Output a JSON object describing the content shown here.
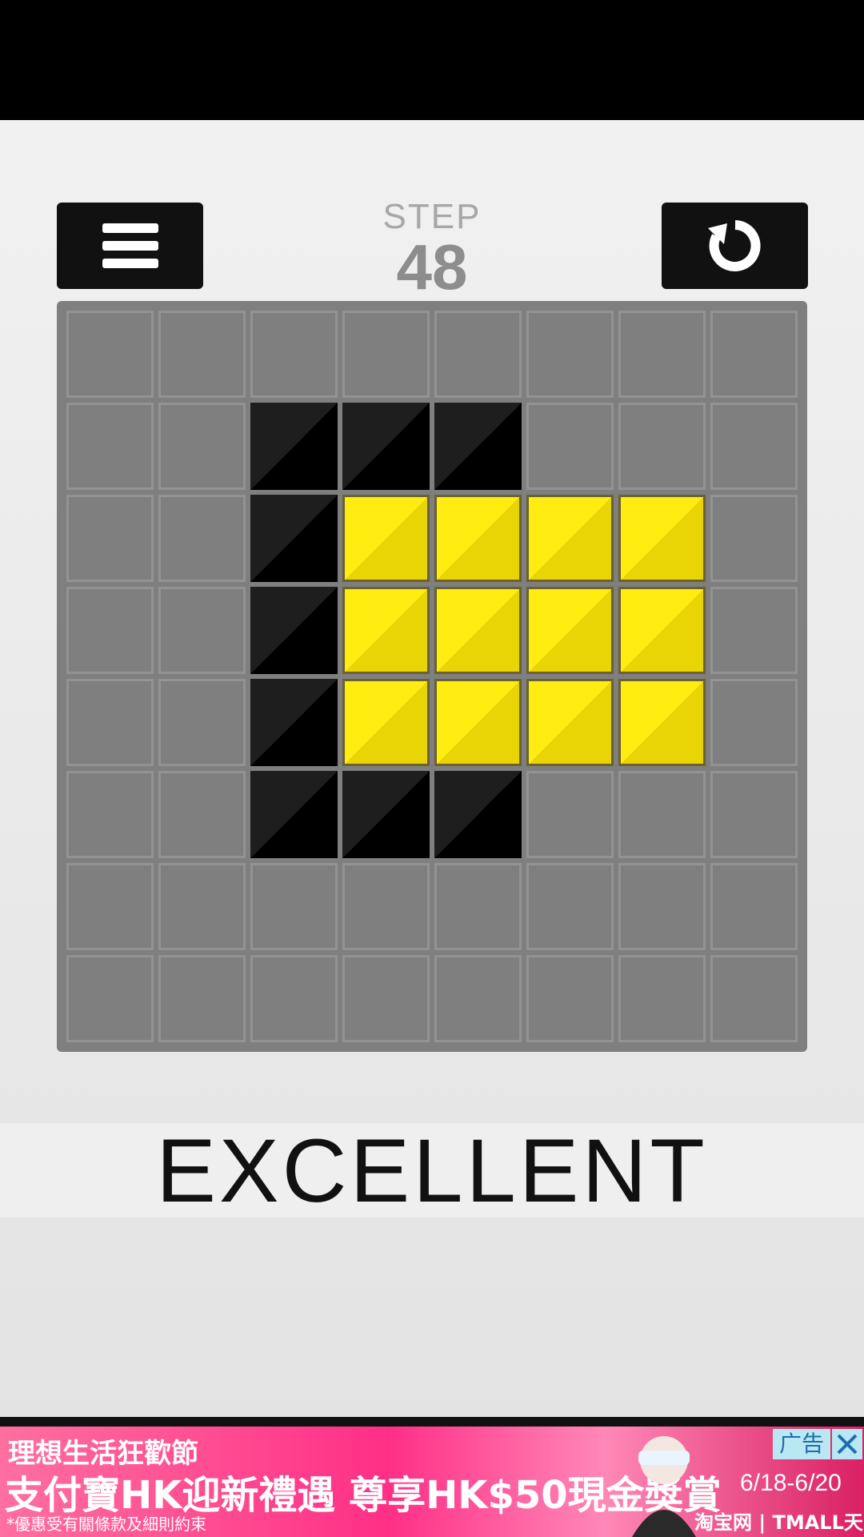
{
  "header": {
    "step_label": "STEP",
    "step_value": "48"
  },
  "icons": {
    "menu": "hamburger-icon",
    "restart": "restart-icon"
  },
  "board": {
    "rows": 8,
    "cols": 8,
    "cells": [
      [
        0,
        0,
        0,
        0,
        0,
        0,
        0,
        0
      ],
      [
        0,
        0,
        1,
        1,
        1,
        0,
        0,
        0
      ],
      [
        0,
        0,
        1,
        2,
        2,
        2,
        2,
        0
      ],
      [
        0,
        0,
        1,
        2,
        2,
        2,
        2,
        0
      ],
      [
        0,
        0,
        1,
        2,
        2,
        2,
        2,
        0
      ],
      [
        0,
        0,
        1,
        1,
        1,
        0,
        0,
        0
      ],
      [
        0,
        0,
        0,
        0,
        0,
        0,
        0,
        0
      ],
      [
        0,
        0,
        0,
        0,
        0,
        0,
        0,
        0
      ]
    ],
    "legend": {
      "0": "empty",
      "1": "black",
      "2": "yellow"
    },
    "colors": {
      "empty": "#7f7f7f",
      "black": "#000000",
      "yellow": "#ffe80f"
    }
  },
  "result": {
    "text": "EXCELLENT"
  },
  "ad": {
    "line1": "理想生活狂歡節",
    "line2": "支付寶HK迎新禮遇 尊享HK$50現金獎賞",
    "line3": "*優惠受有關條款及細則約束",
    "badge": "广告",
    "date": "6/18-6/20",
    "brand": "淘宝网 | TMALL天猫"
  }
}
